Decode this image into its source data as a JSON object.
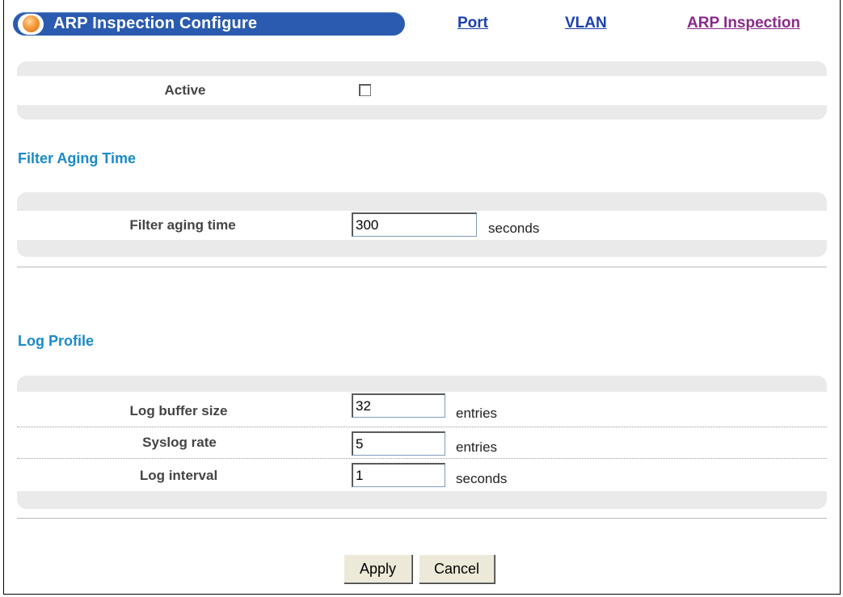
{
  "header": {
    "title": "ARP Inspection Configure",
    "links": {
      "port": "Port",
      "vlan": "VLAN",
      "arp_inspection": "ARP Inspection"
    }
  },
  "active": {
    "label": "Active",
    "checked": false
  },
  "filter_aging": {
    "section_title": "Filter Aging Time",
    "label": "Filter aging time",
    "value": "300",
    "unit": "seconds"
  },
  "log_profile": {
    "section_title": "Log Profile",
    "rows": [
      {
        "label": "Log buffer size",
        "value": "32",
        "unit": "entries"
      },
      {
        "label": "Syslog rate",
        "value": "5",
        "unit": "entries"
      },
      {
        "label": "Log interval",
        "value": "1",
        "unit": "seconds"
      }
    ]
  },
  "buttons": {
    "apply": "Apply",
    "cancel": "Cancel"
  },
  "colors": {
    "header_pill": "#2a5bb0",
    "section_title": "#1a8ac9",
    "link": "#1a3fae",
    "visited_link": "#8a2a8a",
    "panel": "#eaeaea"
  }
}
